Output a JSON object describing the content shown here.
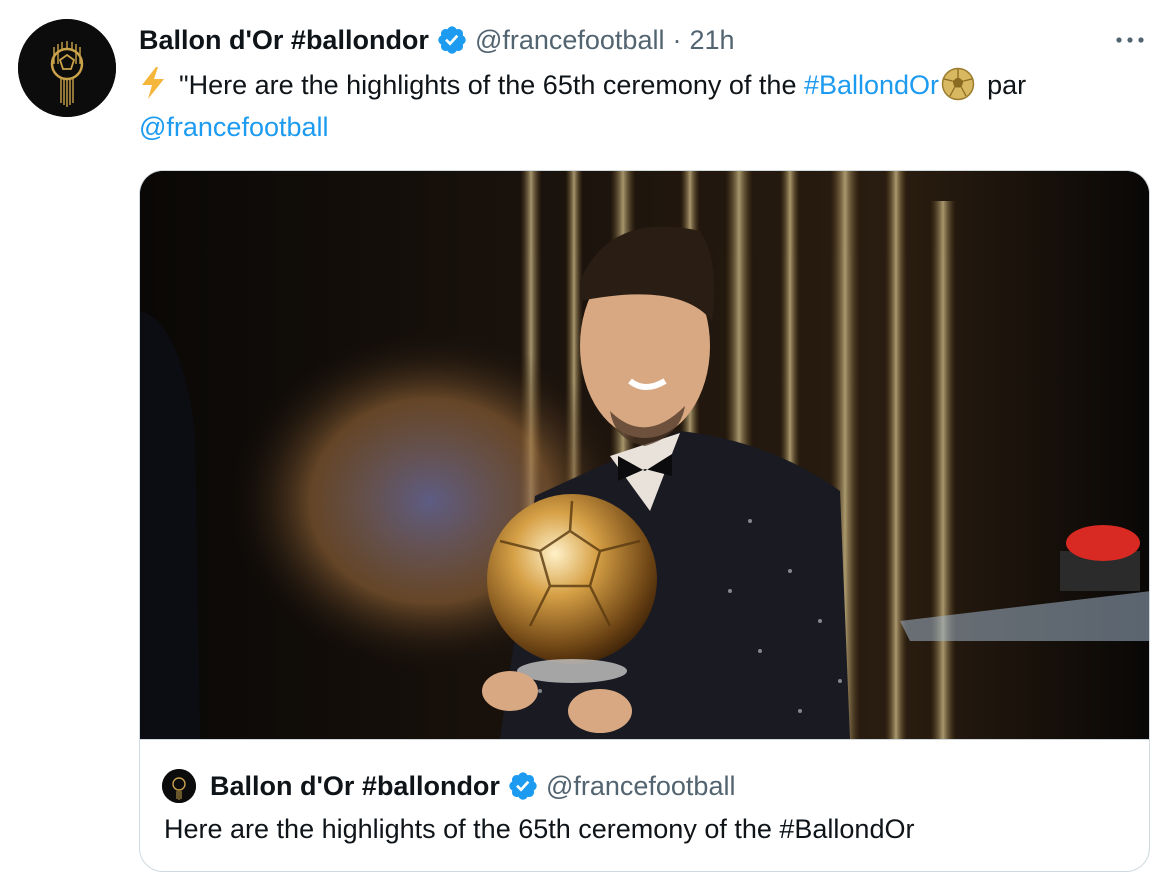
{
  "tweet": {
    "author_name": "Ballon d'Or #ballondor",
    "handle": "@francefootball",
    "separator": "·",
    "time": "21h",
    "text_part1": "\"Here are the highlights of the 65th ceremony of the ",
    "hashtag": "#BallondOr",
    "text_part2": "par",
    "mention": "@francefootball"
  },
  "quote_card": {
    "author_name": "Ballon d'Or #ballondor",
    "handle": "@francefootball",
    "text": "Here are the highlights of the 65th ceremony of the #BallondOr",
    "media_icon": "photo-of-trophy-winner"
  },
  "icons": {
    "verified": "verified-badge-icon",
    "more": "more-options-icon",
    "bolt": "lightning-emoji",
    "ball": "soccer-ball-emoji"
  },
  "colors": {
    "link": "#1d9bf0",
    "verified": "#1d9bf0",
    "secondary_text": "#536471",
    "border": "#cfd9de"
  }
}
